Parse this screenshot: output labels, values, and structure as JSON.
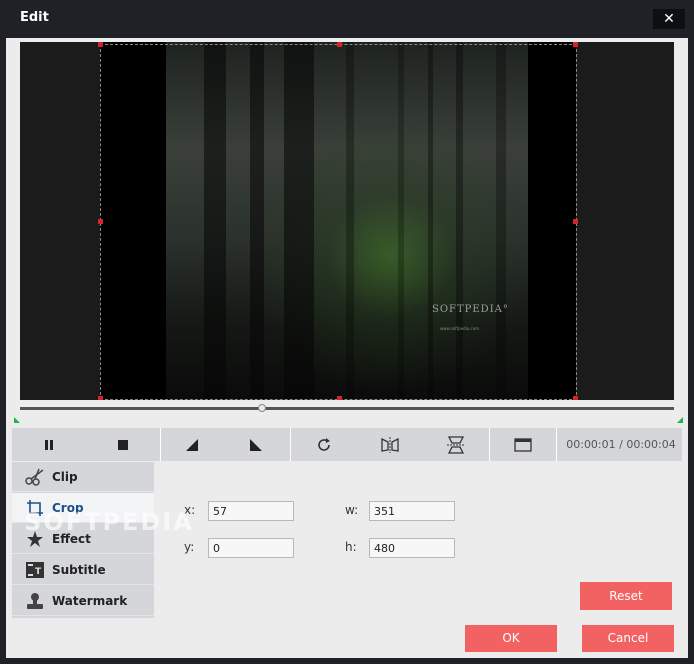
{
  "window": {
    "title": "Edit",
    "close_label": "✕"
  },
  "preview": {
    "watermark": "SOFTPEDIA°",
    "watermark_url": "www.softpedia.com"
  },
  "player": {
    "progress": 0.37,
    "time_current": "00:00:01",
    "time_separator": "/",
    "time_total": "00:00:04",
    "timecode": "00:00:01 / 00:00:04"
  },
  "sidebar": {
    "items": [
      {
        "label": "Clip",
        "icon": "scissors-icon",
        "active": false
      },
      {
        "label": "Crop",
        "icon": "crop-icon",
        "active": true
      },
      {
        "label": "Effect",
        "icon": "star-icon",
        "active": false
      },
      {
        "label": "Subtitle",
        "icon": "subtitle-icon",
        "active": false
      },
      {
        "label": "Watermark",
        "icon": "stamp-icon",
        "active": false
      }
    ]
  },
  "crop": {
    "x_label": "x:",
    "x_value": "57",
    "y_label": "y:",
    "y_value": "0",
    "w_label": "w:",
    "w_value": "351",
    "h_label": "h:",
    "h_value": "480",
    "reset_label": "Reset"
  },
  "background_watermark": "SOFTPEDIA",
  "footer": {
    "ok_label": "OK",
    "cancel_label": "Cancel"
  },
  "colors": {
    "accent": "#f26262",
    "titlebar": "#1f2126",
    "handle": "#d3242c",
    "trim_marker": "#22b24c"
  }
}
